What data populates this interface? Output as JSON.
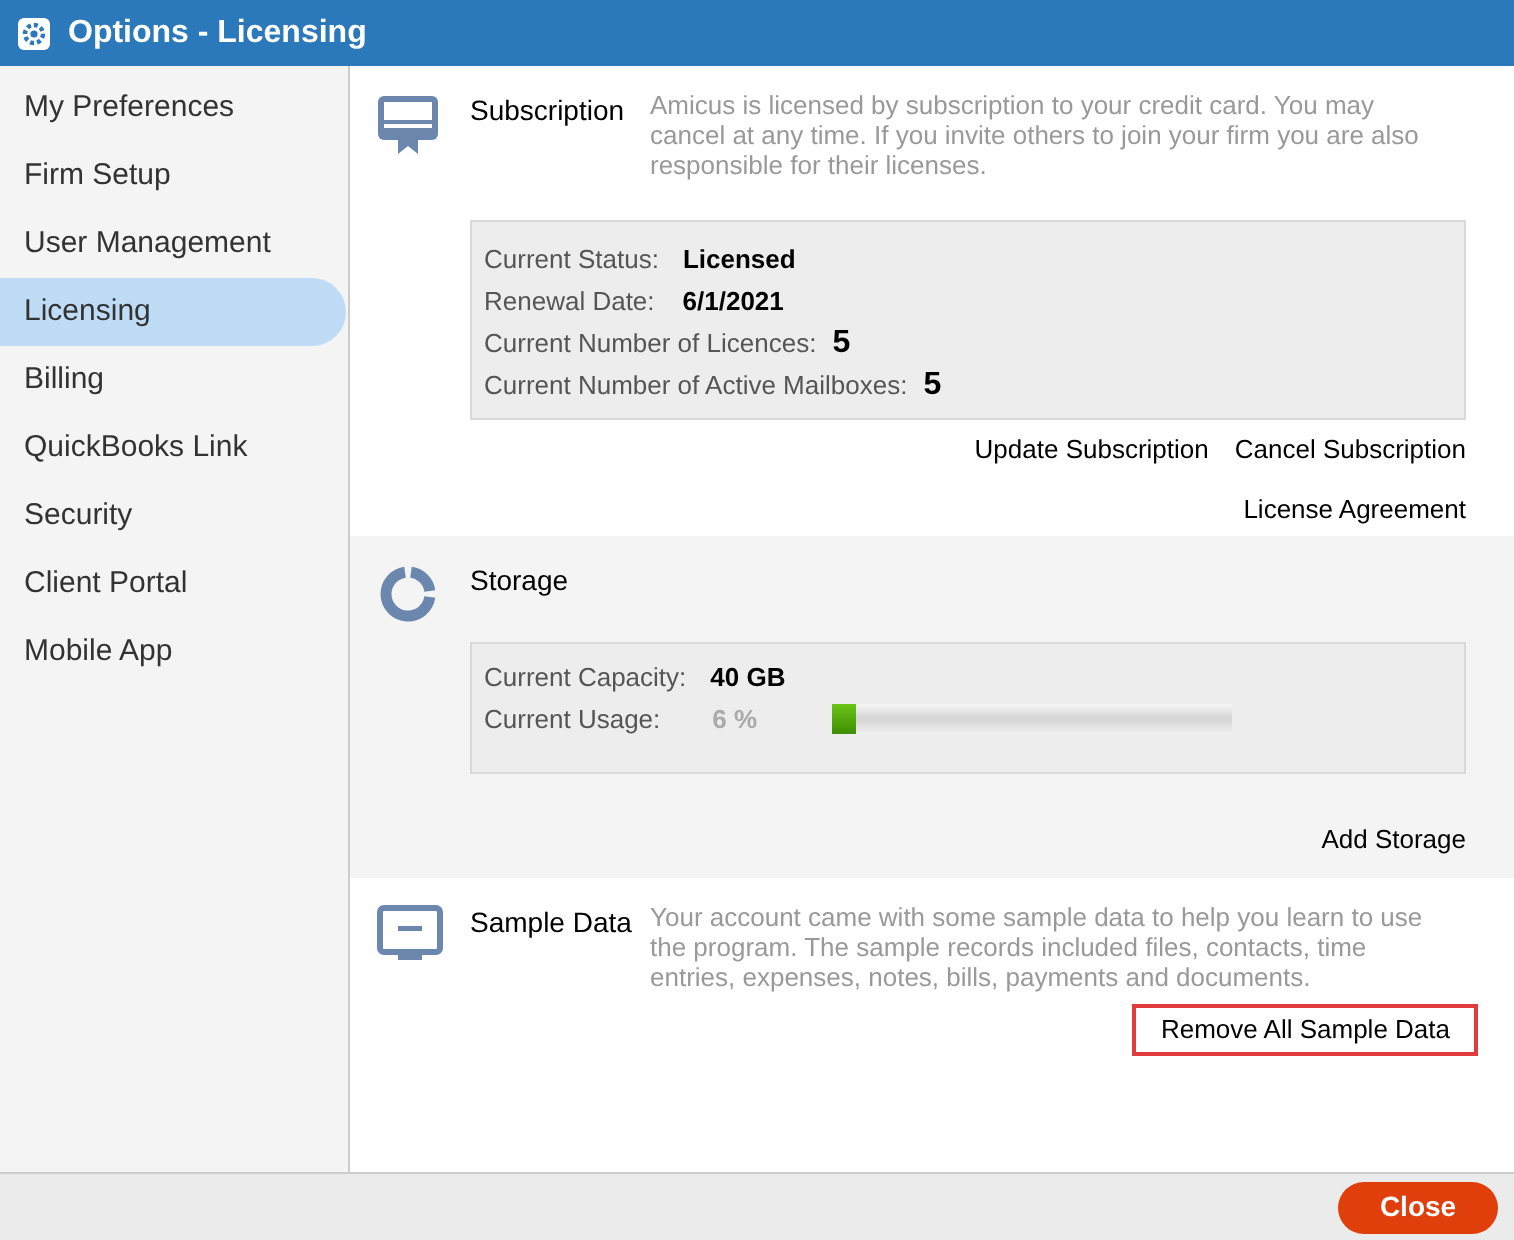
{
  "window": {
    "title": "Options - Licensing"
  },
  "sidebar": {
    "items": [
      {
        "label": "My Preferences",
        "selected": false
      },
      {
        "label": "Firm Setup",
        "selected": false
      },
      {
        "label": "User Management",
        "selected": false
      },
      {
        "label": "Licensing",
        "selected": true
      },
      {
        "label": "Billing",
        "selected": false
      },
      {
        "label": "QuickBooks Link",
        "selected": false
      },
      {
        "label": "Security",
        "selected": false
      },
      {
        "label": "Client Portal",
        "selected": false
      },
      {
        "label": "Mobile App",
        "selected": false
      }
    ]
  },
  "sections": [
    {
      "kind": "subscription",
      "title": "Subscription",
      "description": "Amicus is licensed by subscription to your credit card. You may cancel at any time. If you invite others to join your firm you are also responsible for their licenses.",
      "details": [
        {
          "label": "Current Status:",
          "value": "Licensed",
          "kind": "text"
        },
        {
          "label": "Renewal Date:",
          "value": "6/1/2021",
          "kind": "text"
        },
        {
          "label": "Current Number of Licences:",
          "value": "5",
          "kind": "count"
        },
        {
          "label": "Current Number of Active Mailboxes:",
          "value": "5",
          "kind": "count"
        }
      ],
      "action_rows": [
        [
          {
            "label": "Update Subscription",
            "highlighted": false
          },
          {
            "label": "Cancel Subscription",
            "highlighted": false
          }
        ],
        [
          {
            "label": "License Agreement",
            "highlighted": false
          }
        ]
      ]
    },
    {
      "kind": "storage",
      "title": "Storage",
      "details": [
        {
          "label": "Current Capacity:",
          "value": "40 GB",
          "kind": "text"
        },
        {
          "label": "Current Usage:",
          "value": "6 %",
          "kind": "usage",
          "level": 0.06
        }
      ],
      "action_rows": [
        [
          {
            "label": "Add Storage",
            "highlighted": false
          }
        ]
      ]
    },
    {
      "kind": "sample",
      "title": "Sample Data",
      "description": "Your account came with some sample data to help you learn to use the program. The sample records included files, contacts, time entries, expenses, notes, bills, payments and documents.",
      "action_rows": [
        [
          {
            "label": "Remove All Sample Data",
            "highlighted": true
          }
        ]
      ]
    }
  ],
  "footer": {
    "close_button": "Close"
  }
}
